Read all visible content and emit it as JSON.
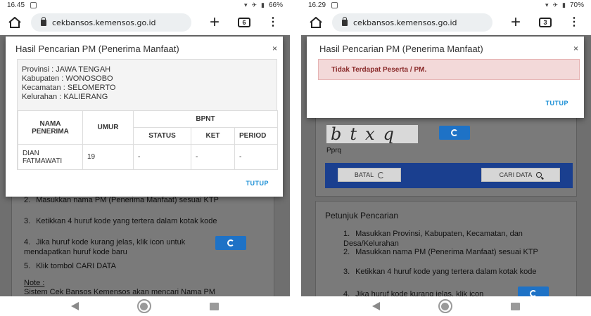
{
  "left": {
    "status": {
      "time": "16.45",
      "battery": "66%"
    },
    "browser": {
      "url": "cekbansos.kemensos.go.id",
      "tab_count": "6"
    },
    "modal": {
      "title": "Hasil Pencarian PM (Penerima Manfaat)",
      "close": "×",
      "info": {
        "provinsi": "Provinsi : JAWA TENGAH",
        "kabupaten": "Kabupaten : WONOSOBO",
        "kecamatan": "Kecamatan : SELOMERTO",
        "kelurahan": "Kelurahan : KALIERANG"
      },
      "table": {
        "col_nama": "NAMA PENERIMA",
        "col_umur": "UMUR",
        "col_group": "BPNT",
        "col_status": "STATUS",
        "col_ket": "KET",
        "col_period": "PERIOD",
        "row": {
          "nama": "DIAN FATMAWATI",
          "umur": "19",
          "status": "-",
          "ket": "-",
          "period": "-"
        }
      },
      "tutup": "TUTUP"
    },
    "steps": [
      {
        "n": "2.",
        "text": "Masukkan nama PM (Penerima Manfaat) sesuai KTP"
      },
      {
        "n": "3.",
        "text": "Ketikkan 4 huruf kode yang tertera dalam kotak kode"
      },
      {
        "n": "4.",
        "text": "Jika huruf kode kurang jelas, klik icon untuk mendapatkan huruf kode baru"
      },
      {
        "n": "5.",
        "text": "Klik tombol CARI DATA"
      }
    ],
    "note_title": "Note :",
    "note_text": "Sistem Cek Bansos Kemensos akan mencari Nama PM"
  },
  "right": {
    "status": {
      "time": "16.29",
      "battery": "70%"
    },
    "browser": {
      "url": "cekbansos.kemensos.go.id",
      "tab_count": "3"
    },
    "modal": {
      "title": "Hasil Pencarian PM (Penerima Manfaat)",
      "close": "×",
      "alert": "Tidak Terdapat Peserta / PM.",
      "tutup": "TUTUP"
    },
    "captcha_text": "btxq",
    "captcha_input": "Pprq",
    "batal": "BATAL",
    "cari": "CARI DATA",
    "petunjuk_title": "Petunjuk Pencarian",
    "steps": [
      {
        "n": "1.",
        "text": "Masukkan Provinsi, Kabupaten, Kecamatan, dan Desa/Kelurahan"
      },
      {
        "n": "2.",
        "text": "Masukkan nama PM (Penerima Manfaat) sesuai KTP"
      },
      {
        "n": "3.",
        "text": "Ketikkan 4 huruf kode yang tertera dalam kotak kode"
      },
      {
        "n": "4.",
        "text": "Jika huruf kode kurang jelas, klik icon"
      }
    ]
  },
  "colors": {
    "accent": "#1a8fd6",
    "button_blue": "#1e72c6",
    "bar_navy": "#1a3f8f",
    "alert_bg": "#f3d9d9",
    "alert_text": "#8a2a2a"
  }
}
